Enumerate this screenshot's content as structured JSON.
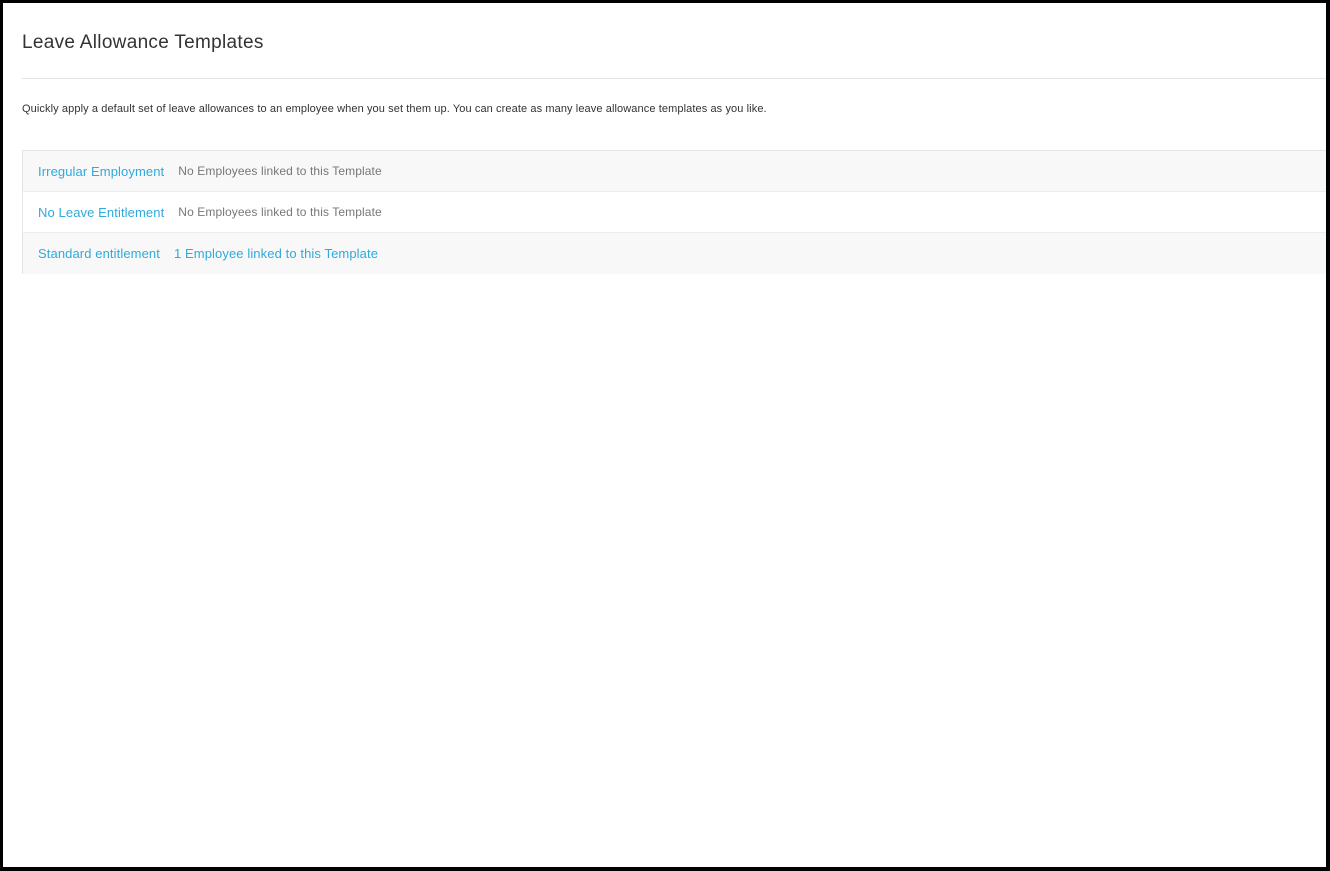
{
  "page": {
    "title": "Leave Allowance Templates",
    "description": "Quickly apply a default set of leave allowances to an employee when you set them up. You can create as many leave allowance templates as you like."
  },
  "templates": [
    {
      "name": "Irregular Employment",
      "employees": "No Employees linked to this Template"
    },
    {
      "name": "No Leave Entitlement",
      "employees": "No Employees linked to this Template"
    },
    {
      "name": "Standard entitlement",
      "employees": "1 Employee linked to this Template"
    }
  ],
  "colors": {
    "link": "#2eaadc",
    "muted_text": "#777777",
    "heading": "#333333",
    "row_alt_background": "#f8f8f8",
    "border": "#e4e4e4"
  }
}
